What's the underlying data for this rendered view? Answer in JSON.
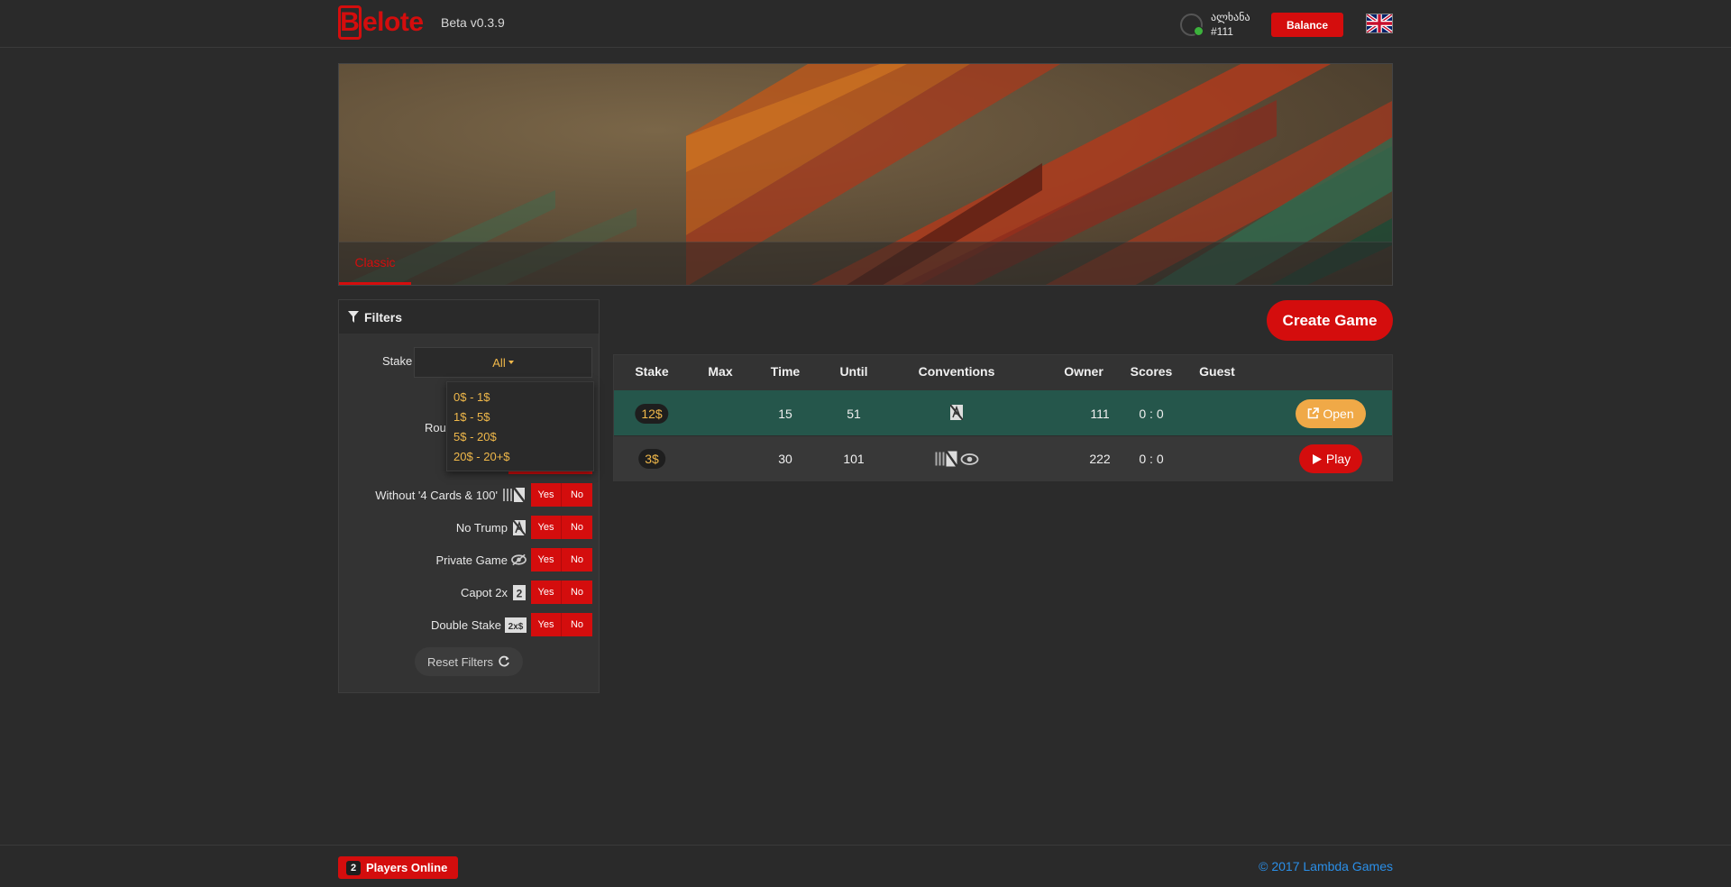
{
  "header": {
    "logo_first": "B",
    "logo_rest": "elote",
    "version": "Beta v0.3.9",
    "user_name": "ალხანა",
    "user_id": "#111",
    "balance_label": "Balance",
    "language_icon": "uk-flag-icon"
  },
  "banner": {
    "tab_label": "Classic"
  },
  "filters": {
    "title": "Filters",
    "stake_label": "Stake",
    "stake_value": "All",
    "stake_options": [
      "0$ - 1$",
      "1$ - 5$",
      "5$ - 20$",
      "20$ - 20+$"
    ],
    "round_label": "Roun",
    "rows": [
      {
        "label": "Without '4 Cards & 100'",
        "icon": "no-four-cards-icon"
      },
      {
        "label": "No Trump",
        "icon": "no-trump-icon"
      },
      {
        "label": "Private Game",
        "icon": "eye-slash-icon"
      },
      {
        "label": "Capot 2x",
        "icon": "capot-2x-icon"
      },
      {
        "label": "Double Stake",
        "icon": "double-stake-icon"
      }
    ],
    "yes_label": "Yes",
    "no_label": "No",
    "reset_label": "Reset Filters"
  },
  "create_game_label": "Create Game",
  "games": {
    "columns": [
      "Stake",
      "Max",
      "Time",
      "Until",
      "Conventions",
      "Owner",
      "Scores",
      "Guest"
    ],
    "rows": [
      {
        "stake": "12$",
        "max": "",
        "time": "15",
        "until": "51",
        "owner": "111",
        "scores": "0 : 0",
        "guest": "",
        "action": "Open"
      },
      {
        "stake": "3$",
        "max": "",
        "time": "30",
        "until": "101",
        "owner": "222",
        "scores": "0 : 0",
        "guest": "",
        "action": "Play"
      }
    ]
  },
  "footer": {
    "online_count": "2",
    "online_label": "Players Online",
    "copyright": "© 2017 Lambda Games"
  },
  "colors": {
    "accent": "#d40d0d",
    "gold": "#f0b84a",
    "row_highlight": "#25564b",
    "link": "#2a8fe8"
  }
}
